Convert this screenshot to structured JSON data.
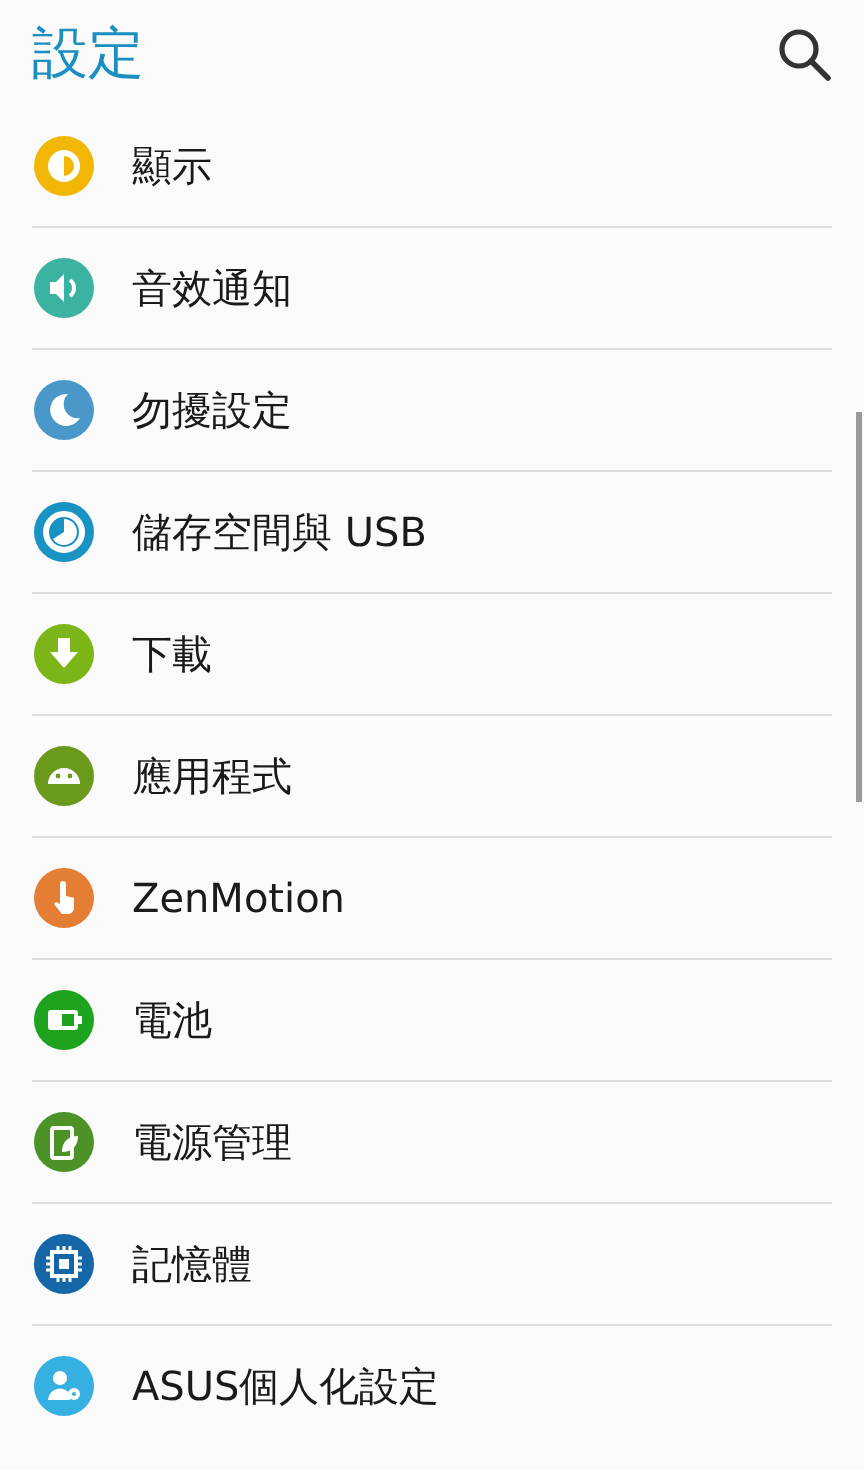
{
  "header": {
    "title": "設定"
  },
  "items": [
    {
      "label": "顯示",
      "kind": "brightness",
      "color": "#f2b705"
    },
    {
      "label": "音效通知",
      "kind": "volume",
      "color": "#3bb3a0"
    },
    {
      "label": "勿擾設定",
      "kind": "moon",
      "color": "#4a98c9"
    },
    {
      "label": "儲存空間與 USB",
      "kind": "storage",
      "color": "#1993c4"
    },
    {
      "label": "下載",
      "kind": "download",
      "color": "#7cb518"
    },
    {
      "label": "應用程式",
      "kind": "android",
      "color": "#6a9a1c"
    },
    {
      "label": "ZenMotion",
      "kind": "touch",
      "color": "#e57e35"
    },
    {
      "label": "電池",
      "kind": "battery",
      "color": "#1ea31e"
    },
    {
      "label": "電源管理",
      "kind": "leaf",
      "color": "#4c9226"
    },
    {
      "label": "記憶體",
      "kind": "chip",
      "color": "#1667a8"
    },
    {
      "label": "ASUS個人化設定",
      "kind": "person",
      "color": "#36b0e0"
    }
  ]
}
